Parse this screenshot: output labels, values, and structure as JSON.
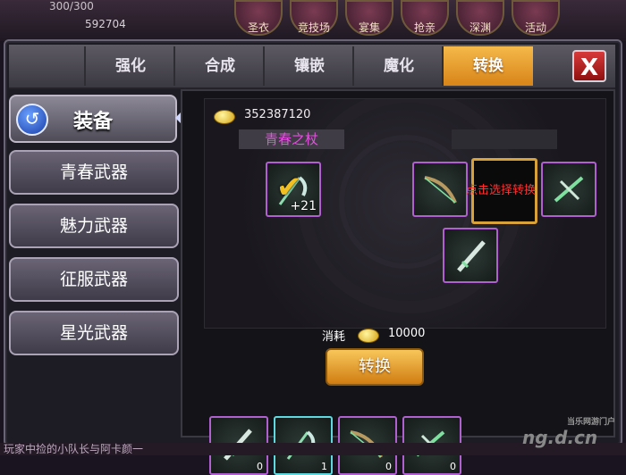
{
  "top": {
    "resource_1": "300/300",
    "resource_2": "592704",
    "nav": [
      "圣衣",
      "竞技场",
      "宴集",
      "抢亲",
      "深渊",
      "活动"
    ]
  },
  "tabs": [
    "强化",
    "合成",
    "镶嵌",
    "魔化",
    "转换"
  ],
  "active_tab": "转换",
  "close_label": "X",
  "sidebar": {
    "header": "装备",
    "items": [
      "青春武器",
      "魅力武器",
      "征服武器",
      "星光武器"
    ]
  },
  "main": {
    "gold": "352387120",
    "item_name": "青春之杖",
    "item_level": "+21",
    "select_prompt": "点击选择转换",
    "cost_label": "消耗",
    "cost_amount": "10000",
    "convert_label": "转换"
  },
  "inventory": [
    {
      "icon": "green-sword-icon",
      "count": "0"
    },
    {
      "icon": "green-scythe-icon",
      "count": "1"
    },
    {
      "icon": "green-bow-icon",
      "count": "0"
    },
    {
      "icon": "green-crossbow-icon",
      "count": "0"
    }
  ],
  "footer_text": "玩家中捡的小队长与阿卡颜一",
  "watermark": "ng.d.cn",
  "watermark_sub": "当乐网游门户",
  "colors": {
    "accent": "#e89a2a",
    "item_name": "#e452e0",
    "select_prompt": "#ff3030",
    "slot_purple": "#b060d0",
    "slot_cyan": "#5fd9e0"
  }
}
